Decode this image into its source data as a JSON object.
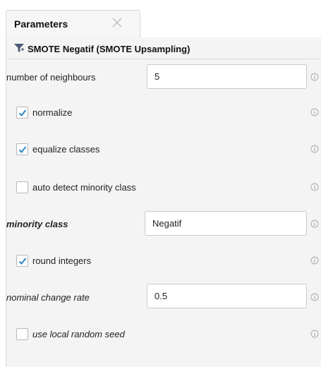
{
  "tab": {
    "label": "Parameters"
  },
  "operator": {
    "title": "SMOTE Negatif (SMOTE Upsampling)"
  },
  "params": {
    "neighbours": {
      "label": "number of neighbours",
      "value": "5"
    },
    "normalize": {
      "label": "normalize",
      "checked": true
    },
    "equalize": {
      "label": "equalize classes",
      "checked": true
    },
    "auto_detect": {
      "label": "auto detect minority class",
      "checked": false
    },
    "minority_class": {
      "label": "minority class",
      "value": "Negatif"
    },
    "round_integers": {
      "label": "round integers",
      "checked": true
    },
    "nominal_rate": {
      "label": "nominal change rate",
      "value": "0.5"
    },
    "local_seed": {
      "label": "use local random seed",
      "checked": false
    }
  },
  "colors": {
    "checkmark": "#2a86c8",
    "panel_bg": "#f4f4f4"
  },
  "icons": {
    "tab_close": "close-icon",
    "operator": "filter-icon",
    "info": "info-icon"
  }
}
